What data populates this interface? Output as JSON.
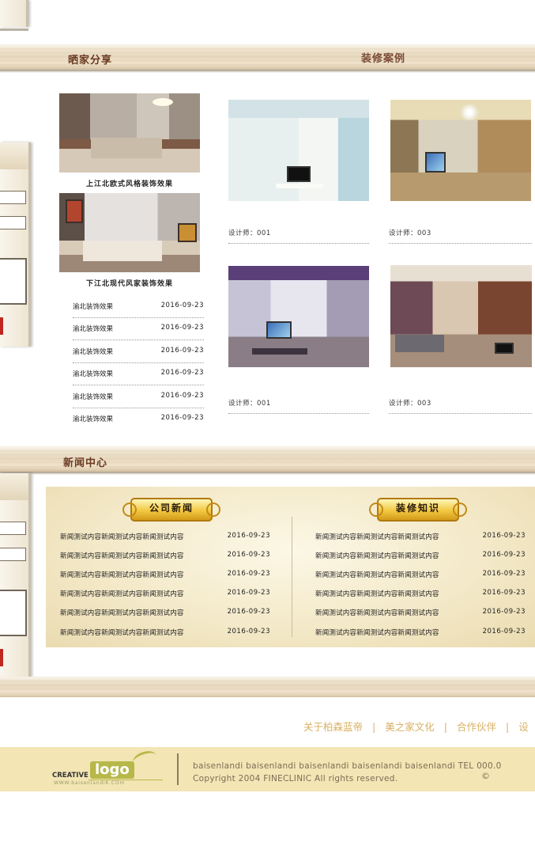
{
  "sections": {
    "share_title": "晒家分享",
    "cases_title": "装修案例",
    "news_title": "新闻中心"
  },
  "share": {
    "featured": [
      {
        "caption": "上江北欧式风格装饰效果"
      },
      {
        "caption": "下江北现代风家装饰效果"
      }
    ],
    "list": [
      {
        "title": "渝北装饰效果",
        "date": "2016-09-23"
      },
      {
        "title": "渝北装饰效果",
        "date": "2016-09-23"
      },
      {
        "title": "渝北装饰效果",
        "date": "2016-09-23"
      },
      {
        "title": "渝北装饰效果",
        "date": "2016-09-23"
      },
      {
        "title": "渝北装饰效果",
        "date": "2016-09-23"
      },
      {
        "title": "渝北装饰效果",
        "date": "2016-09-23"
      }
    ]
  },
  "cases": [
    {
      "designer": "设计师：001"
    },
    {
      "designer": "设计师：003"
    },
    {
      "designer": "设计师：001"
    },
    {
      "designer": "设计师：003"
    }
  ],
  "news": {
    "company": {
      "heading": "公司新闻",
      "items": [
        {
          "title": "新闻测试内容新闻测试内容新闻测试内容",
          "date": "2016-09-23"
        },
        {
          "title": "新闻测试内容新闻测试内容新闻测试内容",
          "date": "2016-09-23"
        },
        {
          "title": "新闻测试内容新闻测试内容新闻测试内容",
          "date": "2016-09-23"
        },
        {
          "title": "新闻测试内容新闻测试内容新闻测试内容",
          "date": "2016-09-23"
        },
        {
          "title": "新闻测试内容新闻测试内容新闻测试内容",
          "date": "2016-09-23"
        },
        {
          "title": "新闻测试内容新闻测试内容新闻测试内容",
          "date": "2016-09-23"
        }
      ]
    },
    "knowledge": {
      "heading": "装修知识",
      "items": [
        {
          "title": "新闻测试内容新闻测试内容新闻测试内容",
          "date": "2016-09-23"
        },
        {
          "title": "新闻测试内容新闻测试内容新闻测试内容",
          "date": "2016-09-23"
        },
        {
          "title": "新闻测试内容新闻测试内容新闻测试内容",
          "date": "2016-09-23"
        },
        {
          "title": "新闻测试内容新闻测试内容新闻测试内容",
          "date": "2016-09-23"
        },
        {
          "title": "新闻测试内容新闻测试内容新闻测试内容",
          "date": "2016-09-23"
        },
        {
          "title": "新闻测试内容新闻测试内容新闻测试内容",
          "date": "2016-09-23"
        }
      ]
    }
  },
  "footer": {
    "links": [
      "关于柏森蓝帝",
      "美之家文化",
      "合作伙伴",
      "设"
    ],
    "separator": "|",
    "logo": {
      "creative": "CREATIVE",
      "word": "logo",
      "url": "WWW.baisenlandiK.COm"
    },
    "line1": "baisenlandi baisenlandi baisenlandi baisenlandi baisenlandi   TEL 000.0",
    "line2": "Copyright   2004 FINECLINIC All rights reserved.",
    "copyright_symbol": "©"
  },
  "colors": {
    "section_title": "#6b3a22",
    "footer_link": "#d9b062",
    "footer_bar": "#f3e5b4",
    "badge_gold": "#f2c842",
    "left_accent_red": "#c0271f"
  }
}
